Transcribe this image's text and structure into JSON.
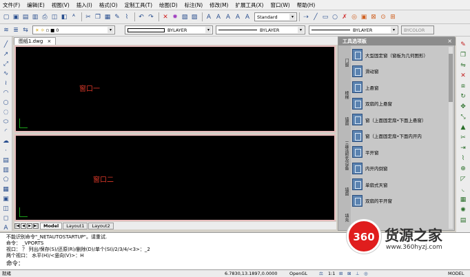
{
  "menu": [
    "文件(F)",
    "编辑(E)",
    "视图(V)",
    "插入(I)",
    "格式(O)",
    "定制工具(T)",
    "绘图(D)",
    "标注(N)",
    "修改(M)",
    "扩展工具(X)",
    "窗口(W)",
    "帮助(H)"
  ],
  "toolbar": {
    "text_style": "Standard",
    "layer_value": "0",
    "color_value": "BYLAYER",
    "linetype_value": "BYLAYER",
    "lineweight_value": "BYLAYER",
    "plotstyle_value": "BYCOLOR"
  },
  "document": {
    "tab_label": "图纸1.dwg",
    "close_glyph": "×"
  },
  "viewports": {
    "top_label": "窗口一",
    "bottom_label": "窗口二"
  },
  "layout_tabs": [
    "Model",
    "Layout1",
    "Layout2"
  ],
  "palette": {
    "title": "工具选项板",
    "side_tabs": [
      "门窗",
      "楼梯",
      "三维造型及设备",
      "墙面",
      "填充"
    ],
    "items": [
      "大型固定窗（窗板为几何图形）",
      "滑动窗",
      "上悬窗",
      "双扇的上悬窗",
      "窗（上面固定扇•下面上悬窗）",
      "窗（上面固定扇•下面内开内",
      "平开窗",
      "内开内倒窗",
      "单扇式天窗",
      "双扇的平开窗"
    ]
  },
  "command": {
    "lines": [
      "不能识别命令\"_NETAUTOSTARTUP\"。请重试.",
      "命令：  _VPORTS",
      "视口：  ？ 列出/保存(S)/还原(R)/删除(D)/单个(SI)/2/3/4/<3>：_2",
      "两个视口：  水平(H)/<竖向(V)>：H"
    ],
    "prompt": "命令："
  },
  "status": {
    "left": "就绪",
    "coords": "6.7830,13.1897,0.0000",
    "renderer": "OpenGL",
    "scale": "1:1",
    "space": "MODEL"
  },
  "watermark": {
    "logo": "360",
    "name": "货源之家",
    "url": "www.360hyzj.com"
  },
  "colors": {
    "viewport_bg": "#000000",
    "viewport_border": "#e8bcbc",
    "viewport_label": "#e23a2a",
    "palette_icon": "#5b83b0"
  }
}
